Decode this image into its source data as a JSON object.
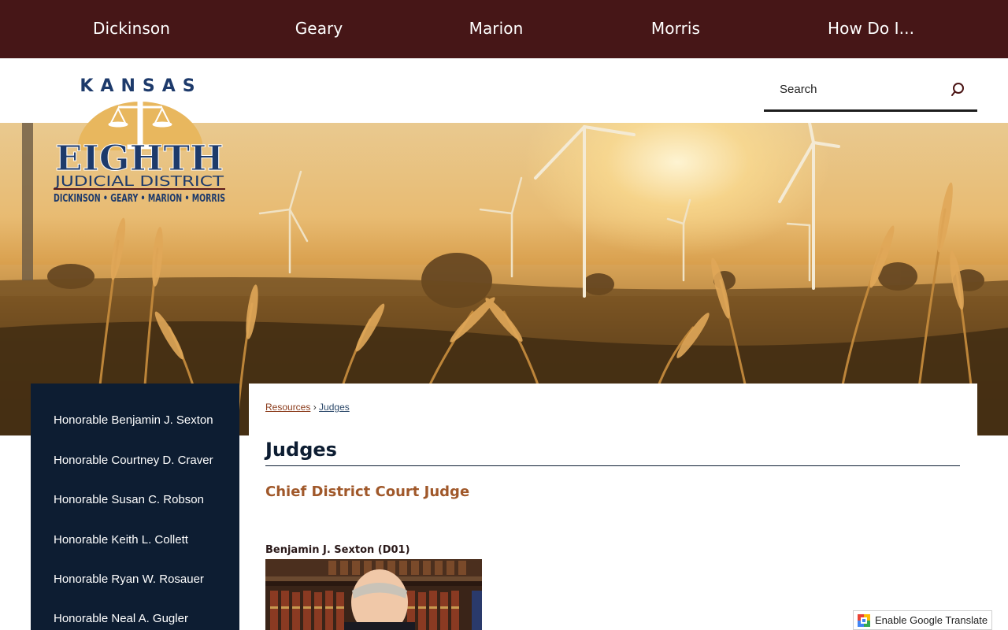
{
  "topnav": {
    "items": [
      "Dickinson",
      "Geary",
      "Marion",
      "Morris",
      "How Do I..."
    ]
  },
  "search": {
    "placeholder": "Search",
    "icon": "search-icon"
  },
  "logo": {
    "top_text": "KANSAS",
    "main_text": "EIGHTH",
    "sub_text": "JUDICIAL DISTRICT",
    "counties_text": "DICKINSON • GEARY • MARION • MORRIS"
  },
  "sidebar": {
    "items": [
      "Honorable Benjamin J. Sexton",
      "Honorable Courtney D. Craver",
      "Honorable Susan C. Robson",
      "Honorable Keith L. Collett",
      "Honorable Ryan W. Rosauer",
      "Honorable Neal A. Gugler"
    ]
  },
  "breadcrumb": {
    "parent": "Resources",
    "separator": "›",
    "current": "Judges"
  },
  "content": {
    "title": "Judges",
    "subheading": "Chief District Court Judge",
    "judge_name": "Benjamin J. Sexton (D01)"
  },
  "translate": {
    "label": "Enable Google Translate"
  },
  "colors": {
    "nav_bg": "#461617",
    "sidebar_bg": "#0d1d32",
    "accent": "#a0582a"
  }
}
